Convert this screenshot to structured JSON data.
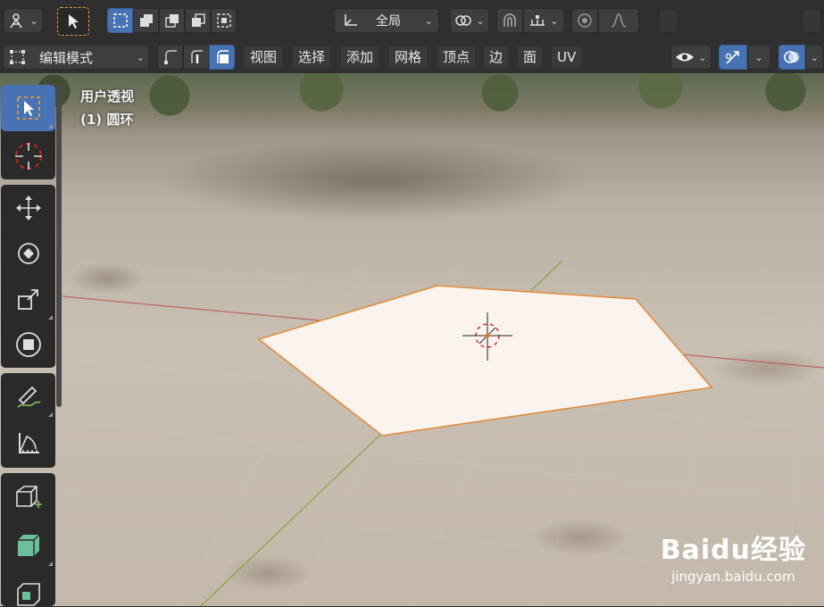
{
  "header": {
    "transform_orientation": "全局",
    "icons": [
      "workspace-icon",
      "select-tool-icon",
      "box-select-mode-icons",
      "transform-pivot-icon",
      "snap-icon",
      "proportional-edit-icon"
    ]
  },
  "mode_bar": {
    "mode_label": "编辑模式",
    "menu": [
      "视图",
      "选择",
      "添加",
      "网格",
      "顶点",
      "边",
      "面",
      "UV"
    ]
  },
  "viewport": {
    "view_name": "用户透视",
    "object_label": "(1) 圆环"
  },
  "toolbar": {
    "tools": [
      "select-box",
      "cursor",
      "move",
      "rotate",
      "scale",
      "transform",
      "annotate",
      "measure",
      "add-cube",
      "extrude",
      "inset"
    ]
  },
  "watermark": {
    "logo_text": "Baidu经验",
    "url": "jingyan.baidu.com"
  },
  "colors": {
    "accent": "#4772b3",
    "header_bg": "#2f2f2f",
    "mesh_fill": "#fbf3ee",
    "mesh_edge": "#e08a3a",
    "x_axis": "#c0504d",
    "y_axis": "#7aa33a"
  }
}
